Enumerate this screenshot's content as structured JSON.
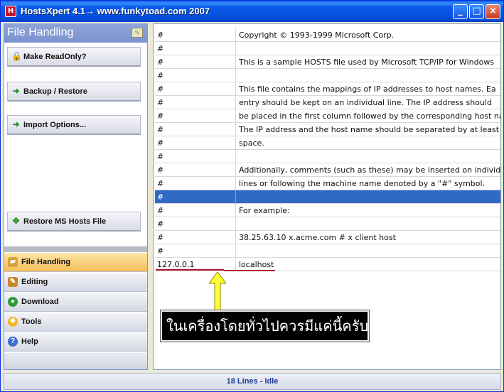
{
  "window": {
    "title": "HostsXpert 4.1→ www.funkytoad.com 2007",
    "icon": "app-icon",
    "controls": [
      "minimize-icon",
      "maximize-icon",
      "close-icon"
    ]
  },
  "left_panel": {
    "header": "File Handling",
    "actions": [
      {
        "label": "Make ReadOnly?",
        "icon": "lock-icon"
      },
      {
        "label": "Backup / Restore",
        "icon": "arrow-right-icon"
      },
      {
        "label": "Import Options...",
        "icon": "arrow-right-icon"
      },
      {
        "label": "Restore MS Hosts File",
        "icon": "restore-icon"
      }
    ],
    "nav": [
      {
        "label": "File Handling",
        "icon": "folder-icon",
        "active": true
      },
      {
        "label": "Editing",
        "icon": "wrench-icon",
        "active": false
      },
      {
        "label": "Download",
        "icon": "globe-icon",
        "active": false
      },
      {
        "label": "Tools",
        "icon": "sun-icon",
        "active": false
      },
      {
        "label": "Help",
        "icon": "help-icon",
        "active": false
      }
    ]
  },
  "grid": {
    "rows": [
      {
        "c1": "#",
        "c2": "Copyright © 1993-1999 Microsoft Corp."
      },
      {
        "c1": "#",
        "c2": ""
      },
      {
        "c1": "#",
        "c2": "This is a sample HOSTS file used by Microsoft TCP/IP for Windows"
      },
      {
        "c1": "#",
        "c2": ""
      },
      {
        "c1": "#",
        "c2": "This file contains the mappings of IP addresses to host names. Ea"
      },
      {
        "c1": "#",
        "c2": "entry should be kept on an individual line. The IP address should"
      },
      {
        "c1": "#",
        "c2": "be placed in the first column followed by the corresponding host na"
      },
      {
        "c1": "#",
        "c2": "The IP address and the host name should be separated by at least"
      },
      {
        "c1": "#",
        "c2": "space."
      },
      {
        "c1": "#",
        "c2": ""
      },
      {
        "c1": "#",
        "c2": "Additionally, comments (such as these) may be inserted on individu"
      },
      {
        "c1": "#",
        "c2": "lines or following the machine name denoted by a \"#\" symbol."
      },
      {
        "c1": "#",
        "c2": "",
        "selected": true
      },
      {
        "c1": "#",
        "c2": "For example:"
      },
      {
        "c1": "#",
        "c2": ""
      },
      {
        "c1": "#",
        "c2": "38.25.63.10 x.acme.com # x client host"
      },
      {
        "c1": "#",
        "c2": ""
      },
      {
        "c1": "127.0.0.1",
        "c2": "localhost"
      }
    ]
  },
  "annotation": {
    "callout_text": "ในเครื่องโดยทั่วไปควรมีแค่นี้ครับ",
    "arrow_color": "#ffff33",
    "underline_color": "#b3122e"
  },
  "status": {
    "text": "18 Lines - Idle"
  }
}
